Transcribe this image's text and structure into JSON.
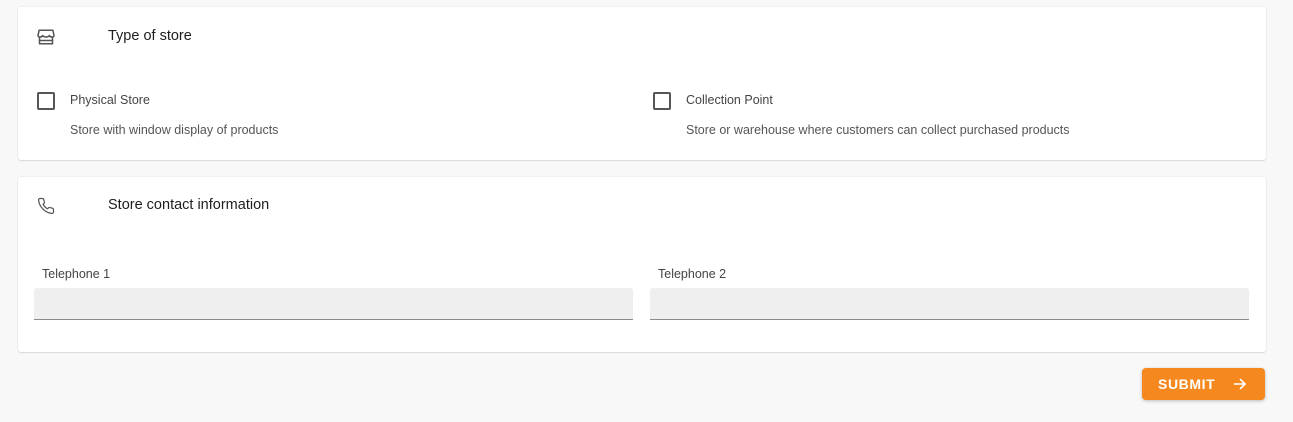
{
  "store_type": {
    "icon": "storefront-icon",
    "title": "Type of store",
    "options": [
      {
        "label": "Physical Store",
        "description": "Store with window display of products",
        "checked": false
      },
      {
        "label": "Collection Point",
        "description": "Store or warehouse where customers can collect purchased products",
        "checked": false
      }
    ]
  },
  "contact": {
    "icon": "phone-icon",
    "title": "Store contact information",
    "fields": [
      {
        "label": "Telephone 1",
        "value": ""
      },
      {
        "label": "Telephone 2",
        "value": ""
      }
    ]
  },
  "submit": {
    "label": "SUBMIT",
    "icon": "arrow-right-icon"
  },
  "colors": {
    "accent": "#f5891f",
    "background": "#f8f8f8",
    "card": "#ffffff",
    "input_fill": "#efefef"
  }
}
